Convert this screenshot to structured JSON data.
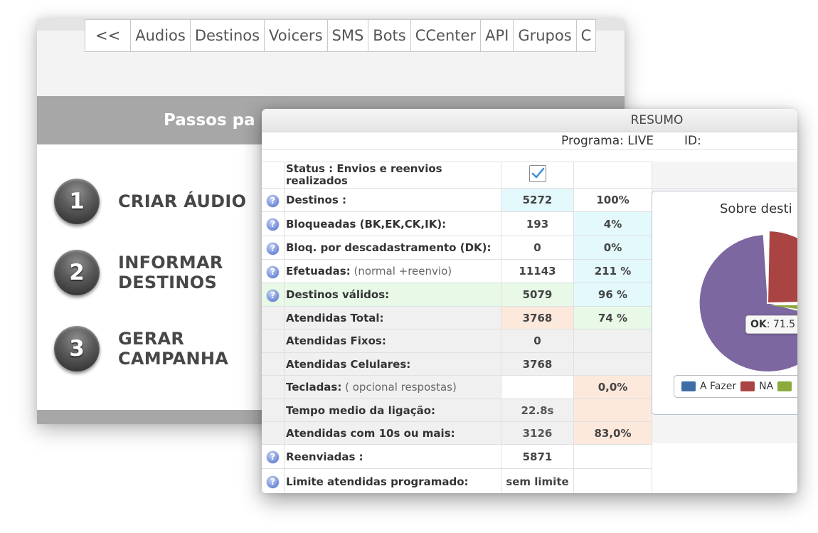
{
  "nav": {
    "tabs": [
      {
        "label": "<<"
      },
      {
        "label": "Audios"
      },
      {
        "label": "Destinos"
      },
      {
        "label": "Voicers"
      },
      {
        "label": "SMS"
      },
      {
        "label": "Bots"
      },
      {
        "label": "CCenter"
      },
      {
        "label": "API"
      },
      {
        "label": "Grupos"
      },
      {
        "label": "C"
      }
    ]
  },
  "steps": {
    "title": "Passos pa",
    "items": [
      {
        "number": "1",
        "label": "CRIAR ÁUDIO"
      },
      {
        "number": "2",
        "label": "INFORMAR\nDESTINOS"
      },
      {
        "number": "3",
        "label": "GERAR\nCAMPANHA"
      }
    ]
  },
  "dialog": {
    "title": "RESUMO",
    "program": "Programa: LIVE",
    "id_label": "ID:",
    "status_label": "Status : Envios e reenvios realizados",
    "status_checked": true
  },
  "rows": [
    {
      "label": "Destinos :",
      "note": "",
      "value": "5272",
      "pct": "100%"
    },
    {
      "label": "Bloqueadas (BK,EK,CK,IK):",
      "note": "",
      "value": "193",
      "pct": "4%"
    },
    {
      "label": "Bloq. por descadastramento (DK):",
      "note": "",
      "value": "0",
      "pct": "0%"
    },
    {
      "label": "Efetuadas:",
      "note": " (normal +reenvio)",
      "value": "11143",
      "pct": "211 %"
    },
    {
      "label": "Destinos válidos:",
      "note": "",
      "value": "5079",
      "pct": "96 %"
    },
    {
      "label": "Atendidas Total:",
      "note": "",
      "value": "3768",
      "pct": "74 %"
    },
    {
      "label": "Atendidas Fixos:",
      "note": "",
      "value": "0",
      "pct": ""
    },
    {
      "label": "Atendidas Celulares:",
      "note": "",
      "value": "3768",
      "pct": ""
    },
    {
      "label": "Tecladas:",
      "note": " ( opcional respostas)",
      "value": "",
      "pct": "0,0%"
    },
    {
      "label": "Tempo medio da ligação:",
      "note": "",
      "value": "22.8s",
      "pct": ""
    },
    {
      "label": "Atendidas com 10s ou mais:",
      "note": "",
      "value": "3126",
      "pct": "83,0%"
    },
    {
      "label": "Reenviadas :",
      "note": "",
      "value": "5871",
      "pct": ""
    },
    {
      "label": "Limite atendidas programado:",
      "note": "",
      "value": "sem limite",
      "pct": ""
    }
  ],
  "chart_data": {
    "type": "pie",
    "title": "Sobre desti",
    "tooltip": {
      "label": "OK",
      "value": ": 71.5"
    },
    "series": [
      {
        "name": "A Fazer",
        "color": "#3f6ea6"
      },
      {
        "name": "NA",
        "color": "#a94442"
      },
      {
        "name": "",
        "color": "#8aab3c"
      },
      {
        "name": "OK",
        "color": "#7d67a0",
        "value": 71.5
      }
    ]
  }
}
